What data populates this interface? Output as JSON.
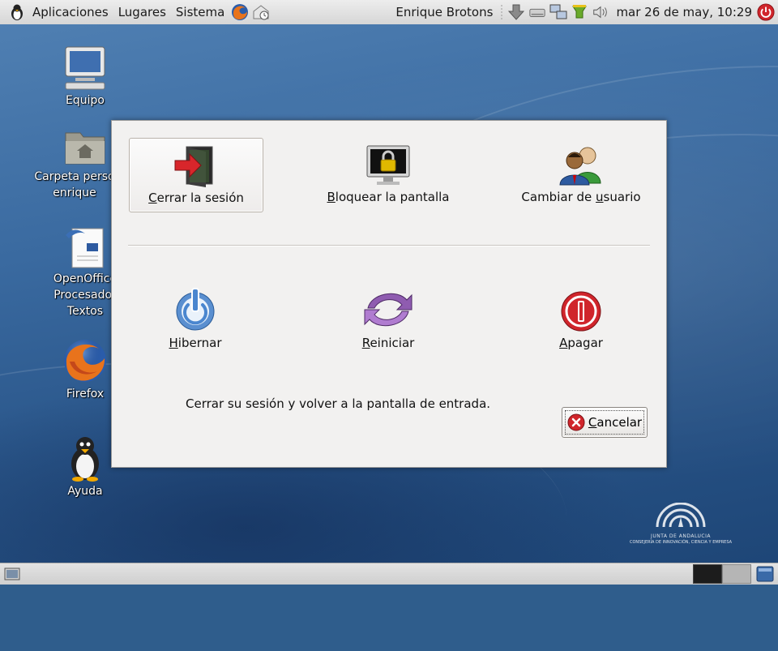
{
  "panel": {
    "menus": [
      "Aplicaciones",
      "Lugares",
      "Sistema"
    ],
    "user": "Enrique Brotons",
    "clock": "mar 26 de may, 10:29"
  },
  "desktop_icons": [
    {
      "label": "Equipo"
    },
    {
      "label": "Carpeta perso\nenrique"
    },
    {
      "label": "OpenOffice\nProcesador\nTextos"
    },
    {
      "label": "Firefox"
    },
    {
      "label": "Ayuda"
    }
  ],
  "dialog": {
    "options": {
      "logout": {
        "pre": "",
        "key": "C",
        "post": "errar la sesión"
      },
      "lock": {
        "pre": "",
        "key": "B",
        "post": "loquear la pantalla"
      },
      "switch_user": {
        "pre": "Cambiar de ",
        "key": "u",
        "post": "suario"
      },
      "hibernate": {
        "pre": "",
        "key": "H",
        "post": "ibernar"
      },
      "restart": {
        "pre": "",
        "key": "R",
        "post": "einiciar"
      },
      "shutdown": {
        "pre": "",
        "key": "A",
        "post": "pagar"
      }
    },
    "description": "Cerrar su sesión y volver a la pantalla de entrada.",
    "cancel": {
      "key": "C",
      "post": "ancelar"
    }
  },
  "logo": {
    "line1": "JUNTA DE ANDALUCIA",
    "line2": "CONSEJERÍA DE INNOVACIÓN, CIENCIA Y EMPRESA"
  },
  "colors": {
    "accent_red": "#d0252b",
    "selection": "#eeeceb",
    "panel": "#dcdcdc"
  }
}
